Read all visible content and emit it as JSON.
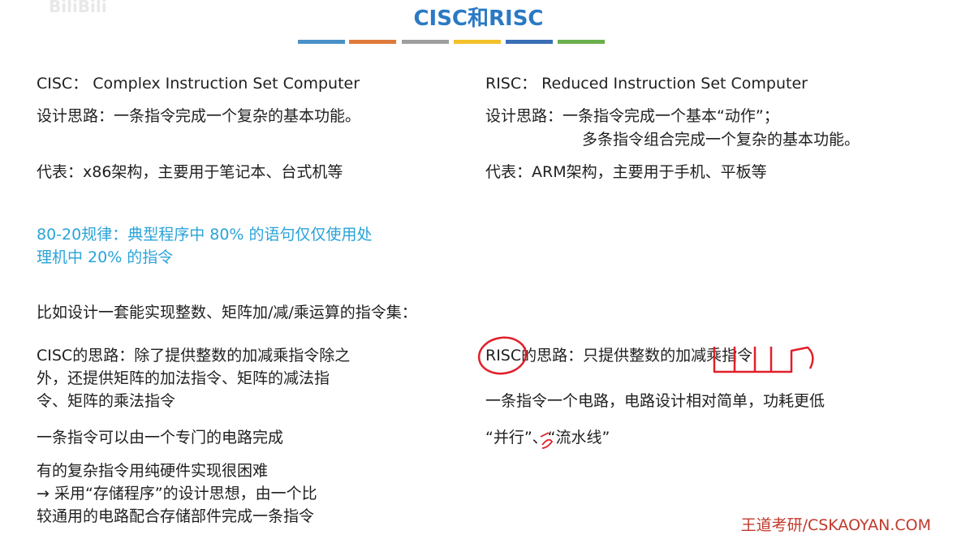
{
  "watermark": "BiliBili",
  "title": "CISC和RISC",
  "colors": [
    "#4a90c8",
    "#e07a3a",
    "#9e9e9e",
    "#f3c12b",
    "#3a6fb5",
    "#6ab04c"
  ],
  "cisc": {
    "heading": "CISC： Complex Instruction Set Computer",
    "design": "设计思路：一条指令完成一个复杂的基本功能。",
    "example": "代表：x86架构，主要用于笔记本、台式机等"
  },
  "risc": {
    "heading": "RISC： Reduced Instruction Set Computer",
    "design_line1": "设计思路：一条指令完成一个基本“动作”；",
    "design_line2": "多条指令组合完成一个复杂的基本功能。",
    "example": "代表：ARM架构，主要用于手机、平板等"
  },
  "rule_8020": {
    "line1": "80-20规律：典型程序中 80% 的语句仅仅使用处",
    "line2": "理机中 20% 的指令"
  },
  "example_intro": "比如设计一套能实现整数、矩阵加/减/乘运算的指令集：",
  "cisc_idea": {
    "line1": "CISC的思路：除了提供整数的加减乘指令除之",
    "line2": "外，还提供矩阵的加法指令、矩阵的减法指",
    "line3": "令、矩阵的乘法指令",
    "circuit": "一条指令可以由一个专门的电路完成",
    "hard_line1": "有的复杂指令用纯硬件实现很困难",
    "hard_line2": "→ 采用“存储程序”的设计思想，由一个比",
    "hard_line3": "较通用的电路配合存储部件完成一条指令"
  },
  "risc_idea": {
    "line1": "RISC的思路：只提供整数的加减乘指令",
    "circuit": "一条指令一个电路，电路设计相对简单，功耗更低",
    "parallel": "“并行”、“流水线”"
  },
  "footer": "王道考研/CSKAOYAN.COM"
}
